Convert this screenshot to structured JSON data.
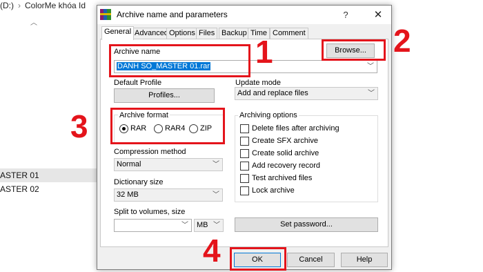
{
  "explorer": {
    "path_drive": "(D:)",
    "path_folder": "ColorMe khóa Id",
    "rows": [
      "ASTER 01",
      "ASTER 02"
    ]
  },
  "dialog": {
    "title": "Archive name and parameters",
    "help_glyph": "?",
    "close_glyph": "✕",
    "tabs": [
      "General",
      "Advanced",
      "Options",
      "Files",
      "Backup",
      "Time",
      "Comment"
    ],
    "archive_name_label": "Archive name",
    "archive_name_value": "DANH SO_MASTER 01.rar",
    "browse_label": "Browse...",
    "default_profile_label": "Default Profile",
    "profiles_button": "Profiles...",
    "update_mode_label": "Update mode",
    "update_mode_value": "Add and replace files",
    "archive_format_label": "Archive format",
    "formats": [
      {
        "label": "RAR",
        "selected": true
      },
      {
        "label": "RAR4",
        "selected": false
      },
      {
        "label": "ZIP",
        "selected": false
      }
    ],
    "archiving_options_label": "Archiving options",
    "options": [
      "Delete files after archiving",
      "Create SFX archive",
      "Create solid archive",
      "Add recovery record",
      "Test archived files",
      "Lock archive"
    ],
    "compression_method_label": "Compression method",
    "compression_method_value": "Normal",
    "dictionary_size_label": "Dictionary size",
    "dictionary_size_value": "32 MB",
    "split_label": "Split to volumes, size",
    "split_value": "",
    "split_unit": "MB",
    "set_password_button": "Set password...",
    "ok_button": "OK",
    "cancel_button": "Cancel",
    "help_button": "Help"
  },
  "annotations": {
    "step1": "1",
    "step2": "2",
    "step3": "3",
    "step4": "4",
    "color": "#e4141b"
  }
}
